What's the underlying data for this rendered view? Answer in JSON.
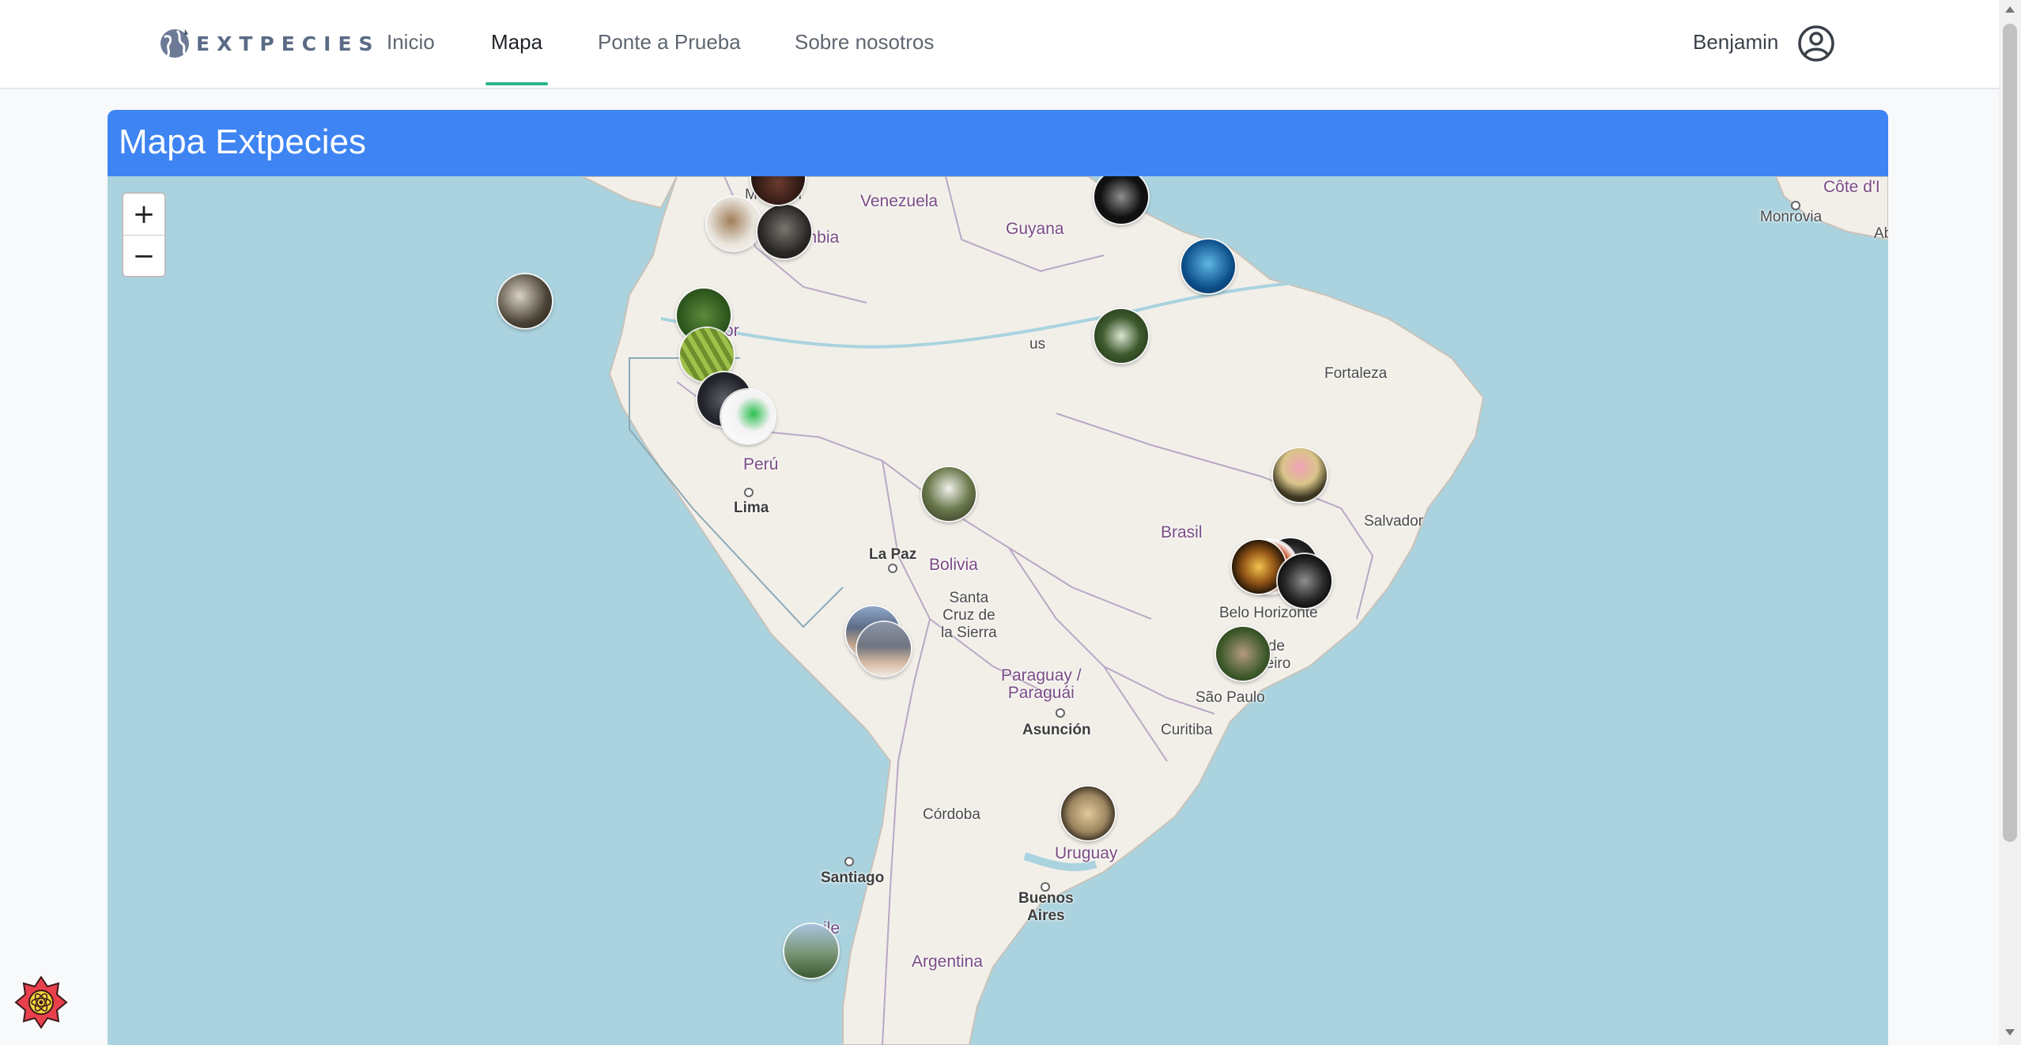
{
  "header": {
    "logo_text": "EXTPECIES",
    "nav": [
      {
        "label": "Inicio",
        "active": false
      },
      {
        "label": "Mapa",
        "active": true
      },
      {
        "label": "Ponte a Prueba",
        "active": false
      },
      {
        "label": "Sobre nosotros",
        "active": false
      }
    ],
    "user_name": "Benjamin",
    "user_icon": "user-circle-icon",
    "accent_color": "#2bb58b"
  },
  "panel": {
    "title": "Mapa Extpecies",
    "header_color": "#3e84f3"
  },
  "map": {
    "zoom_in_label": "+",
    "zoom_out_label": "−",
    "labels": {
      "medellin": "Medellín",
      "venezuela": "Venezuela",
      "guyana": "Guyana",
      "colombia": "ombia",
      "ecuador": "or",
      "manaus": "us",
      "peru": "Perú",
      "lima": "Lima",
      "lapaz": "La Paz",
      "bolivia": "Bolivia",
      "santacruz": "Santa\nCruz de\nla Sierra",
      "brasil": "Brasil",
      "fortaleza": "Fortaleza",
      "salvador": "Salvador",
      "belohorizonte": "Belo Horizonte",
      "riodejaneiro": "Rio de\nJaneiro",
      "saopaulo": "São Paulo",
      "curitiba": "Curitiba",
      "paraguay": "Paraguay /\nParaguái",
      "asuncion": "Asunción",
      "uruguay": "Uruguay",
      "cordoba": "Córdoba",
      "santiago": "Santiago",
      "buenosaires": "Buenos\nAires",
      "argentina": "Argentina",
      "chile": "ile",
      "monrovia": "Monrovia",
      "cotedivoire": "Côte d'I",
      "abidjan": "Ab"
    },
    "markers": [
      {
        "species": "marker-1",
        "icon": "species-photo"
      },
      {
        "species": "marker-2",
        "icon": "species-photo"
      }
    ]
  },
  "badge_icon": "react-devtools-icon"
}
